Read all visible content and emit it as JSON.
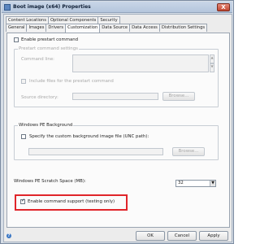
{
  "window": {
    "title": "Boot image (x64) Properties",
    "close_glyph": "X"
  },
  "tabs_row1": [
    "Content Locations",
    "Optional Components",
    "Security"
  ],
  "tabs_row2": [
    "General",
    "Images",
    "Drivers",
    "Customization",
    "Data Source",
    "Data Access",
    "Distribution Settings"
  ],
  "prestart": {
    "enable_label": "Enable prestart command",
    "group_title": "Prestart command settings",
    "command_line_label": "Command line:",
    "include_files_label": "Include files for the prestart command",
    "source_dir_label": "Source directory:",
    "browse_label": "Browse..."
  },
  "background": {
    "group_title": "Windows PE Background",
    "specify_label": "Specify the custom background image file (UNC path):",
    "browse_label": "Browse..."
  },
  "scratch": {
    "label": "Windows PE Scratch Space (MB):",
    "value": "32"
  },
  "command_support": {
    "label": "Enable command support (testing only)",
    "checked": true
  },
  "footer": {
    "ok": "OK",
    "cancel": "Cancel",
    "apply": "Apply",
    "help_glyph": "?"
  },
  "colors": {
    "highlight": "#e0252a",
    "titlebar": "#b4c5dc"
  }
}
